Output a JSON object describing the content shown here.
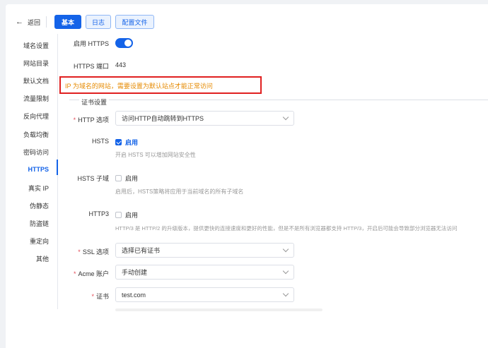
{
  "header": {
    "back_label": "返回",
    "tabs": [
      {
        "label": "基本",
        "active": true
      },
      {
        "label": "日志",
        "active": false
      },
      {
        "label": "配置文件",
        "active": false
      }
    ]
  },
  "sidebar": {
    "items": [
      {
        "label": "域名设置"
      },
      {
        "label": "网站目录"
      },
      {
        "label": "默认文档"
      },
      {
        "label": "流量限制"
      },
      {
        "label": "反向代理"
      },
      {
        "label": "负载均衡"
      },
      {
        "label": "密码访问"
      },
      {
        "label": "HTTPS",
        "active": true
      },
      {
        "label": "真实 IP"
      },
      {
        "label": "伪静态"
      },
      {
        "label": "防盗链"
      },
      {
        "label": "重定向"
      },
      {
        "label": "其他"
      }
    ]
  },
  "form": {
    "enable_https_label": "启用 HTTPS",
    "enable_https_on": true,
    "https_port_label": "HTTPS 端口",
    "https_port_value": "443",
    "warning": "IP 为域名的网站，需要设置为默认站点才能正常访问",
    "cert_section_title": "证书设置",
    "http_option_label": "HTTP 选项",
    "http_option_value": "访问HTTP自动跳转到HTTPS",
    "hsts_label": "HSTS",
    "hsts_check_label": "启用",
    "hsts_checked": true,
    "hsts_hint": "开启 HSTS 可以增加网站安全性",
    "hsts_sub_label": "HSTS 子域",
    "hsts_sub_check_label": "启用",
    "hsts_sub_hint": "启用后，HSTS策略将应用于当前域名的所有子域名",
    "http3_label": "HTTP3",
    "http3_check_label": "启用",
    "http3_hint": "HTTP/3 是 HTTP/2 的升级版本，提供更快的连接速度和更好的性能，但是不是所有浏览器都支持 HTTP/3，开启后可能会导致部分浏览器无法访问",
    "ssl_option_label": "SSL 选项",
    "ssl_option_value": "选择已有证书",
    "acme_label": "Acme 账户",
    "acme_value": "手动创建",
    "cert_label": "证书",
    "cert_value": "test.com",
    "required_mark": "*"
  },
  "colors": {
    "accent": "#1463e8",
    "warning_text": "#e68a00",
    "highlight_border": "#e02020"
  }
}
